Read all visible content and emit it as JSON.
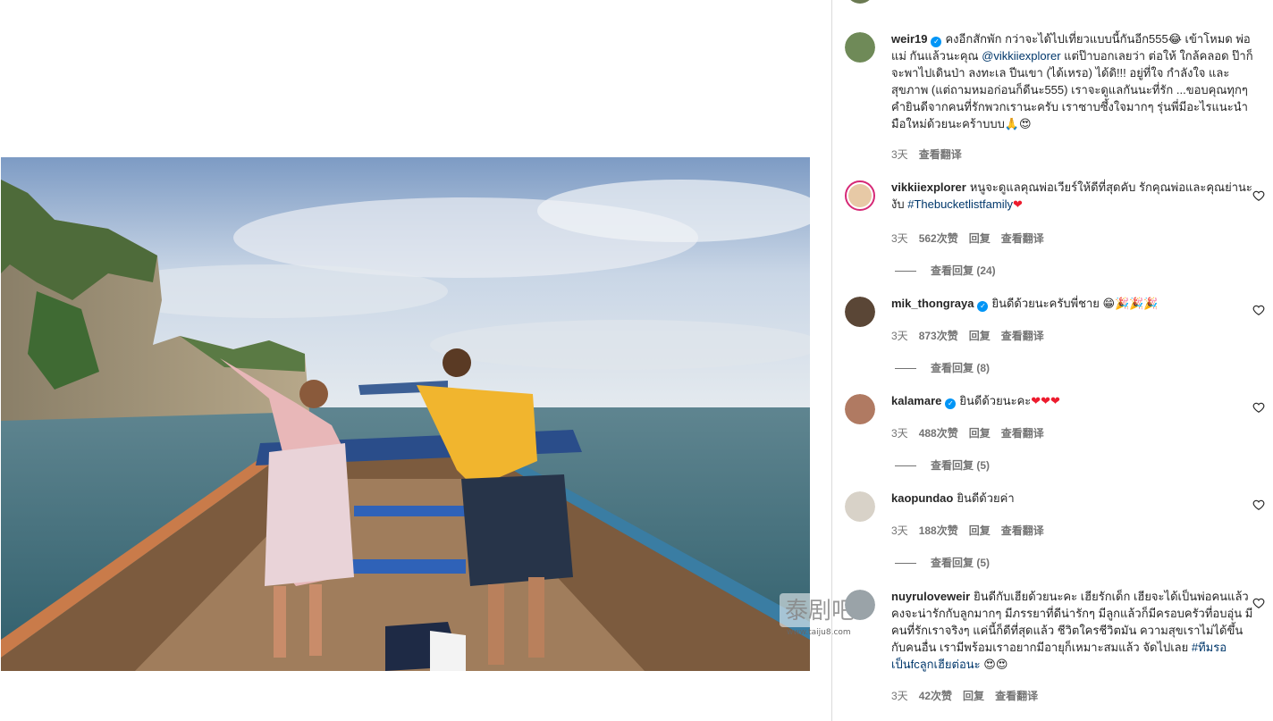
{
  "post": {
    "photo_alt": "Two people posing on the bow of a longtail boat near limestone cliffs",
    "watermark_text": "泰剧吧",
    "watermark_url": "www.taiju8.com"
  },
  "caption": {
    "username": "weir19",
    "verified": true,
    "text_before_mention": "คงอีกสักพัก กว่าจะได้ไปเที่ยวแบบนี้กันอีก555😂 เข้าโหมด พ่อ แม่ กันแล้วนะคุณ ",
    "mention": "@vikkiiexplorer",
    "text_after_mention": " แต่ป๊าบอกเลยว่า ต่อให้ ใกล้คลอด ป๊าก็จะพาไปเดินป่า ลงทะเล ปีนเขา (ได้เหรอ) ได้ดิ!!! อยู่ที่ใจ กำลังใจ และสุขภาพ (แต่ถามหมอก่อนก็ดีนะ555) เราจะดูแลกันนะที่รัก ...ขอบคุณทุกๆคำยินดีจากคนที่รักพวกเรานะครับ เราซาบซึ้งใจมากๆ รุ่นพี่มีอะไรแนะนำมือใหม่ด้วยนะคร้าบบบ🙏😍",
    "time": "3天",
    "translate": "查看翻译"
  },
  "comments": [
    {
      "username": "vikkiiexplorer",
      "verified": false,
      "text": "หนูจะดูแลคุณพ่อเวียร์ให้ดีที่สุดคับ รักคุณพ่อและคุณย่านะงับ ",
      "hashtag": "#Thebucketlistfamily",
      "suffix": "❤",
      "time": "3天",
      "likes": "562次赞",
      "reply": "回复",
      "translate": "查看翻译",
      "view_replies": "查看回复 (24)",
      "avatar_color": "#e7c9a6"
    },
    {
      "username": "mik_thongraya",
      "verified": true,
      "text": "ยินดีด้วยนะครับพี่ชาย 😁🎉🎉🎉",
      "hashtag": "",
      "suffix": "",
      "time": "3天",
      "likes": "873次赞",
      "reply": "回复",
      "translate": "查看翻译",
      "view_replies": "查看回复 (8)",
      "avatar_color": "#5a4636"
    },
    {
      "username": "kalamare",
      "verified": true,
      "text": "ยินดีด้วยนะคะ",
      "hashtag": "",
      "suffix": "❤❤❤",
      "time": "3天",
      "likes": "488次赞",
      "reply": "回复",
      "translate": "查看翻译",
      "view_replies": "查看回复 (5)",
      "avatar_color": "#b07a62"
    },
    {
      "username": "kaopundao",
      "verified": false,
      "text": "ยินดีด้วยค่า",
      "hashtag": "",
      "suffix": "",
      "time": "3天",
      "likes": "188次赞",
      "reply": "回复",
      "translate": "查看翻译",
      "view_replies": "查看回复 (5)",
      "avatar_color": "#d8d2c8"
    },
    {
      "username": "nuyruloveweir",
      "verified": false,
      "text": "ยินดีกับเฮียด้วยนะคะ เฮียรักเด็ก เฮียจะได้เป็นพ่อคนแล้ว คงจะน่ารักกับลูกมากๆ มีภรรยาที่ดีน่ารักๆ มีลูกแล้วก็มีครอบครัวที่อบอุ่น มีคนที่รักเราจริงๆ แค่นี้ก็ดีที่สุดแล้ว ชีวิตใครชีวิตมัน ความสุขเราไม่ได้ขึ้นกับคนอื่น เรามีพร้อมเราอยากมีอายุก็เหมาะสมแล้ว จัดไปเลย ",
      "hashtag": "#ทีมรอเป็นfcลูกเฮียต่อนะ",
      "suffix": "😍😍",
      "time": "3天",
      "likes": "42次赞",
      "reply": "回复",
      "translate": "查看翻译",
      "view_replies": "",
      "avatar_color": "#9aa3a8"
    }
  ],
  "icons": {
    "like": "heart-outline-icon",
    "verified": "verified-badge-icon"
  },
  "colors": {
    "link": "#00376b",
    "verified": "#0095f6",
    "muted": "#737373",
    "heart": "#ed1c2e"
  }
}
